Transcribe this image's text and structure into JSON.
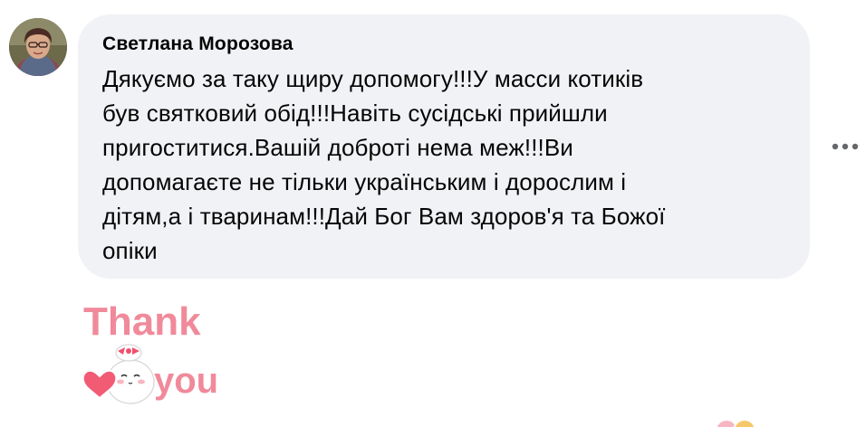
{
  "comment": {
    "author": "Светлана Морозова",
    "text_lines": [
      "Дякуємо за таку щиру допомогу!!!У масси котиків",
      "був святковий обід!!!Навіть сусідські прийшли",
      "пригоститися.Вашій доброті нема меж!!!Ви",
      "допомагаєте не тільки українським і дорослим і",
      "дітям,а і тваринам!!!Дай Бог Вам здоров'я та Божої",
      "опіки"
    ]
  },
  "more_button": {
    "icon": "more-horizontal-icon"
  },
  "sticker": {
    "text_line1": "Thank",
    "text_line2": "you",
    "colors": {
      "text_fill": "#f08a9a",
      "text_outline": "#ffffff",
      "heart": "#f25b74",
      "bunny": "#ffffff",
      "bow": "#f0506e"
    }
  },
  "colors": {
    "bubble_bg": "#f0f2f5",
    "text": "#050505",
    "icon": "#65676b"
  }
}
